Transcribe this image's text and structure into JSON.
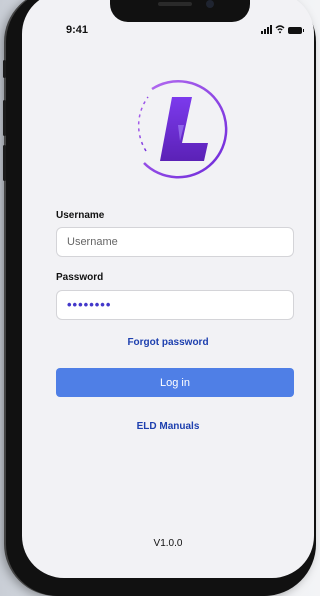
{
  "status_bar": {
    "time": "9:41",
    "signal_icon": "cellular-signal-icon",
    "wifi_icon": "wifi-icon",
    "battery_icon": "battery-icon"
  },
  "logo": {
    "letter": "L",
    "icon": "app-logo",
    "colors": {
      "ring": "#8b3fe0",
      "letter": "#6d28d9"
    }
  },
  "form": {
    "username": {
      "label": "Username",
      "placeholder": "Username",
      "value": ""
    },
    "password": {
      "label": "Password",
      "value": "••••••••"
    },
    "forgot_password": "Forgot password",
    "login_button": "Log in",
    "eld_manuals": "ELD Manuals"
  },
  "footer": {
    "version": "V1.0.0"
  },
  "colors": {
    "primary_button": "#4f7fe6",
    "link": "#1e40af",
    "background": "#f2f2f5"
  }
}
